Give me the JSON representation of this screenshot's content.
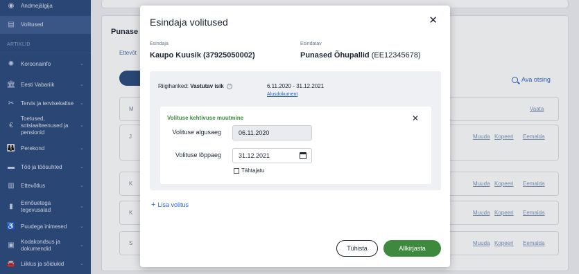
{
  "sidebar": {
    "items": [
      {
        "label": "Andmejälgija",
        "icon": "eye-icon",
        "chevron": false
      },
      {
        "label": "Volitused",
        "icon": "document-icon",
        "chevron": false,
        "active": true
      },
      {
        "label": "Koroonainfo",
        "icon": "virus-icon",
        "chevron": true
      },
      {
        "label": "Eesti Vabariik",
        "icon": "building-icon",
        "chevron": true
      },
      {
        "label": "Tervis ja tervisekaitse",
        "icon": "health-icon",
        "chevron": true
      },
      {
        "label": "Toetused, sotsiaalteenused ja pensionid",
        "icon": "euro-icon",
        "chevron": true
      },
      {
        "label": "Perekond",
        "icon": "family-icon",
        "chevron": true
      },
      {
        "label": "Töö ja töösuhted",
        "icon": "briefcase-icon",
        "chevron": true
      },
      {
        "label": "Ettevõtlus",
        "icon": "company-icon",
        "chevron": true
      },
      {
        "label": "Erinõuetega tegevusalad",
        "icon": "file-icon",
        "chevron": true
      },
      {
        "label": "Puudega inimesed",
        "icon": "accessibility-icon",
        "chevron": true
      },
      {
        "label": "Kodakondsus ja dokumendid",
        "icon": "id-card-icon",
        "chevron": true
      },
      {
        "label": "Liiklus ja sõidukid",
        "icon": "car-icon",
        "chevron": true
      }
    ],
    "section_label": "ARTIKLID"
  },
  "background": {
    "title": "Punase",
    "tab": "Ettevõt",
    "search_link": "Ava otsing",
    "row_links": {
      "view": "Vaata",
      "edit": "Muuda",
      "copy": "Kopeeri",
      "delete": "Eemalda"
    },
    "row_letters": [
      "M",
      "J",
      "K",
      "K",
      "S"
    ]
  },
  "modal": {
    "title": "Esindaja volitused",
    "representative_label": "Esindaja",
    "representative_value": "Kaupo Kuusik (37925050002)",
    "represented_label": "Esindatav",
    "represented_value_bold": "Punased Õhupallid",
    "represented_value_code": "(EE12345678)",
    "procurement_label": "Riigihanked:",
    "procurement_role": "Vastutav isik",
    "date_range": "6.11.2020 - 31.12.2021",
    "basis_link": "Alusdokument",
    "edit_card": {
      "title": "Volituse kehtivuse muutmine",
      "start_label": "Volituse algusaeg",
      "start_value": "06.11.2020",
      "end_label": "Volituse lõppaeg",
      "end_value": "31.12.2021",
      "indefinite_label": "Tähtajatu"
    },
    "add_link": "Lisa volitus",
    "cancel_label": "Tühista",
    "sign_label": "Allkirjasta"
  },
  "colors": {
    "sidebar_bg": "#2c4a7d",
    "accent_green": "#3d8a3f",
    "link_blue": "#2c66c7"
  }
}
